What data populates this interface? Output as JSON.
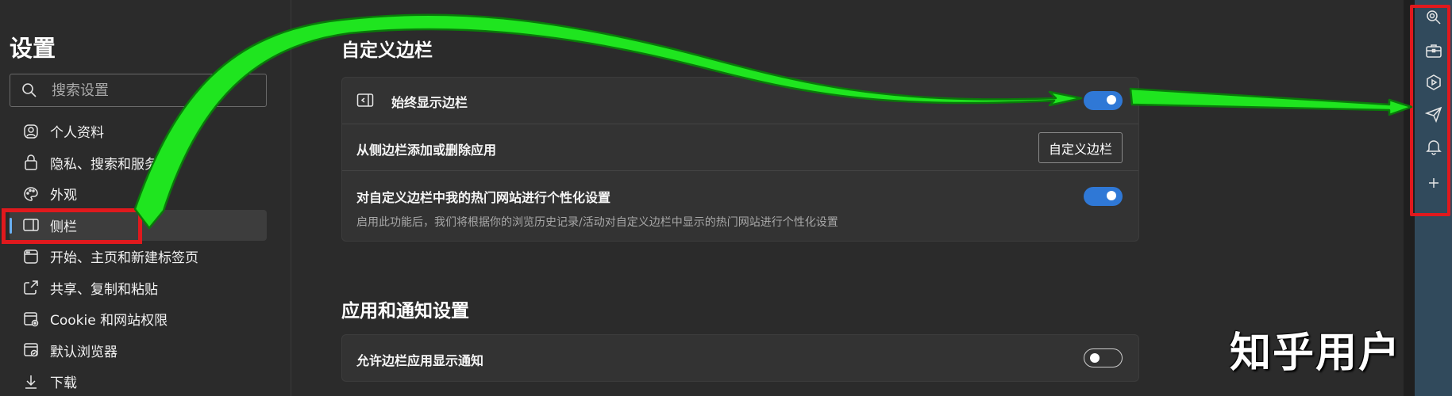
{
  "nav": {
    "title": "设置",
    "search_placeholder": "搜索设置",
    "items": [
      {
        "label": "个人资料",
        "icon": "profile-icon"
      },
      {
        "label": "隐私、搜索和服务",
        "icon": "lock-icon"
      },
      {
        "label": "外观",
        "icon": "palette-icon"
      },
      {
        "label": "侧栏",
        "icon": "sidebar-icon",
        "active": true
      },
      {
        "label": "开始、主页和新建标签页",
        "icon": "home-icon"
      },
      {
        "label": "共享、复制和粘贴",
        "icon": "share-icon"
      },
      {
        "label": "Cookie 和网站权限",
        "icon": "cookie-icon"
      },
      {
        "label": "默认浏览器",
        "icon": "browser-icon"
      },
      {
        "label": "下载",
        "icon": "download-icon"
      }
    ]
  },
  "sections": [
    {
      "title": "自定义边栏",
      "rows": [
        {
          "label": "始终显示边栏",
          "toggle": "on",
          "icon": "sidebar-toggle-icon"
        },
        {
          "label": "从侧边栏添加或删除应用",
          "button": "自定义边栏"
        },
        {
          "label": "对自定义边栏中我的热门网站进行个性化设置",
          "description": "启用此功能后，我们将根据你的浏览历史记录/活动对自定义边栏中显示的热门网站进行个性化设置",
          "toggle": "on"
        }
      ]
    },
    {
      "title": "应用和通知设置",
      "rows": [
        {
          "label": "允许边栏应用显示通知",
          "toggle": "off"
        }
      ]
    }
  ],
  "right_sidebar": {
    "icons": [
      "search-icon",
      "briefcase-icon",
      "games-icon",
      "send-icon",
      "bell-icon",
      "plus-icon"
    ]
  },
  "watermark": "知乎用户",
  "colors": {
    "accent": "#2f78d6",
    "highlight_red": "#e0191d",
    "arrow_green": "#1fe51f",
    "sidebar_bg": "#314a5c"
  }
}
